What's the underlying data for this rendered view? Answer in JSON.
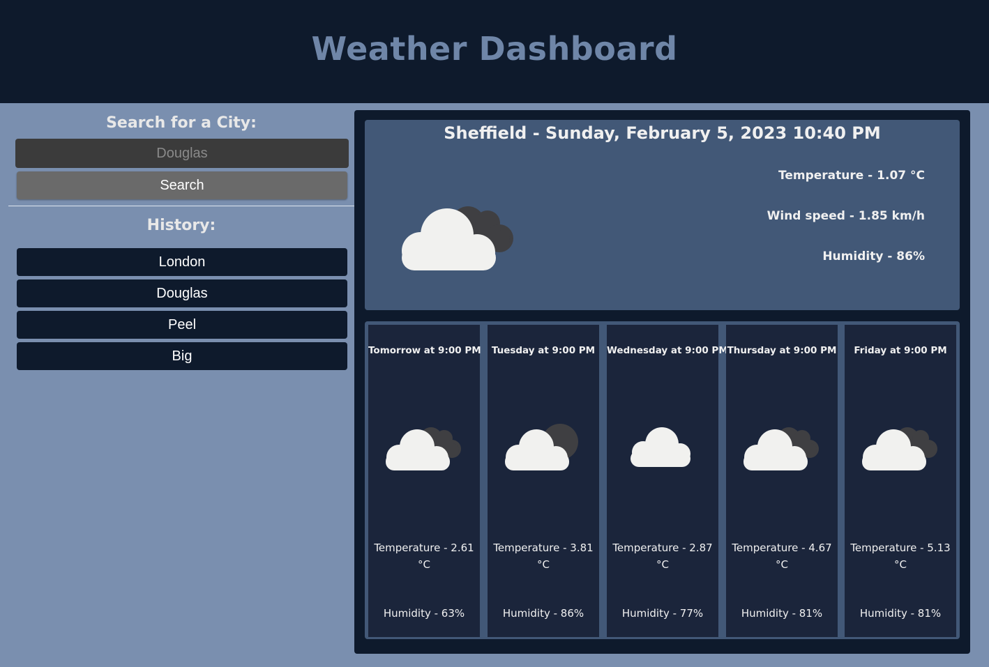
{
  "header": {
    "title": "Weather Dashboard"
  },
  "search": {
    "title": "Search for a City:",
    "value": "Douglas",
    "placeholder": "Douglas",
    "button_label": "Search"
  },
  "history": {
    "title": "History:",
    "items": [
      "London",
      "Douglas",
      "Peel",
      "Big"
    ]
  },
  "current": {
    "title": "Sheffield - Sunday, February 5, 2023 10:40 PM",
    "icon": "broken-clouds-icon",
    "temperature": "Temperature - 1.07 °C",
    "wind": "Wind speed - 1.85 km/h",
    "humidity": "Humidity - 86%"
  },
  "forecast": [
    {
      "title": "Tomorrow at 9:00 PM",
      "icon": "broken-clouds-icon",
      "temperature": "Temperature - 2.61 °C",
      "humidity": "Humidity - 63%"
    },
    {
      "title": "Tuesday at 9:00 PM",
      "icon": "overcast-clouds-icon",
      "temperature": "Temperature - 3.81 °C",
      "humidity": "Humidity - 86%"
    },
    {
      "title": "Wednesday at 9:00 PM",
      "icon": "cloud-icon",
      "temperature": "Temperature - 2.87 °C",
      "humidity": "Humidity - 77%"
    },
    {
      "title": "Thursday at 9:00 PM",
      "icon": "broken-clouds-icon",
      "temperature": "Temperature - 4.67 °C",
      "humidity": "Humidity - 81%"
    },
    {
      "title": "Friday at 9:00 PM",
      "icon": "broken-clouds-icon",
      "temperature": "Temperature - 5.13 °C",
      "humidity": "Humidity - 81%"
    }
  ],
  "colors": {
    "header_bg": "#0e1a2c",
    "page_bg": "#7a8faf",
    "card_bg": "#425877",
    "forecast_card_bg": "#1b253b",
    "title_color": "#6f86a8"
  }
}
